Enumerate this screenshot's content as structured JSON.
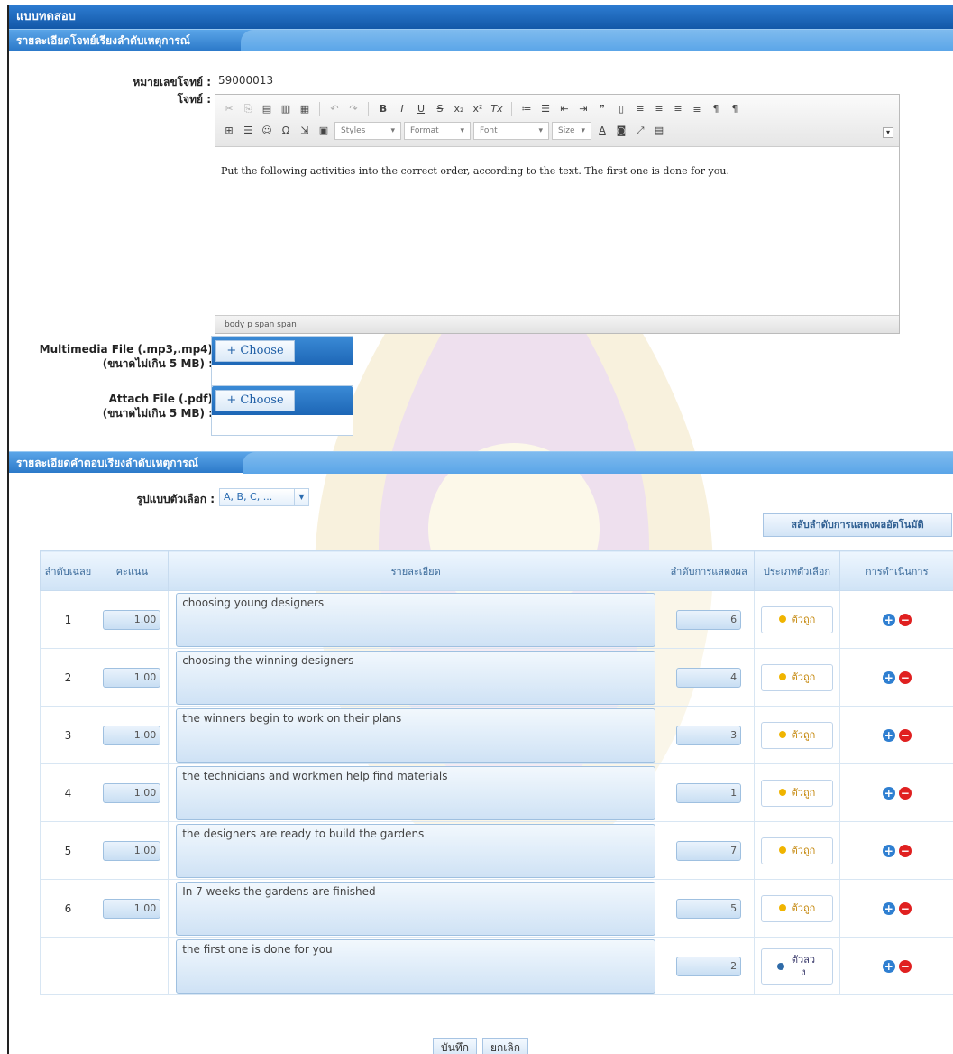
{
  "window": {
    "title": "แบบทดสอบ"
  },
  "question_section": {
    "header": "รายละเอียดโจทย์เรียงลำดับเหตุการณ์",
    "number_label": "หมายเลขโจทย์ :",
    "number_value": "59000013",
    "question_label": "โจทย์ :",
    "editor": {
      "styles": "Styles",
      "format": "Format",
      "font": "Font",
      "size": "Size",
      "content": "Put the following activities into the correct order, according to the text. The first one is done for you.",
      "path": "body  p  span  span"
    },
    "multimedia_label": "Multimedia File (.mp3,.mp4)",
    "multimedia_sub": "(ขนาดไม่เกิน 5 MB) :",
    "attach_label": "Attach File (.pdf)",
    "attach_sub": "(ขนาดไม่เกิน 5 MB) :",
    "choose_label": "+ Choose"
  },
  "answer_section": {
    "header": "รายละเอียดคำตอบเรียงลำดับเหตุการณ์",
    "format_label": "รูปแบบตัวเลือก :",
    "format_value": "A, B, C, ...",
    "auto_button": "สลับลำดับการแสดงผลอัตโนมัติ",
    "columns": [
      "ลำดับเฉลย",
      "คะแนน",
      "รายละเอียด",
      "ลำดับการแสดงผล",
      "ประเภทตัวเลือก",
      "การดำเนินการ"
    ],
    "rows": [
      {
        "order": "1",
        "score": "1.00",
        "detail": "choosing young designers",
        "display": "6",
        "type": "ตัวถูก"
      },
      {
        "order": "2",
        "score": "1.00",
        "detail": "choosing the winning designers",
        "display": "4",
        "type": "ตัวถูก"
      },
      {
        "order": "3",
        "score": "1.00",
        "detail": "the winners begin to work on their plans",
        "display": "3",
        "type": "ตัวถูก"
      },
      {
        "order": "4",
        "score": "1.00",
        "detail": "the technicians and workmen help find materials",
        "display": "1",
        "type": "ตัวถูก"
      },
      {
        "order": "5",
        "score": "1.00",
        "detail": "the designers are ready to build the gardens",
        "display": "7",
        "type": "ตัวถูก"
      },
      {
        "order": "6",
        "score": "1.00",
        "detail": "In 7 weeks the gardens are finished",
        "display": "5",
        "type": "ตัวถูก"
      },
      {
        "order": "",
        "score": "",
        "detail": "the first one is done for you",
        "display": "2",
        "type": "ตัวลวง"
      }
    ]
  },
  "footer": {
    "save": "บันทึก",
    "cancel": "ยกเลิก"
  }
}
